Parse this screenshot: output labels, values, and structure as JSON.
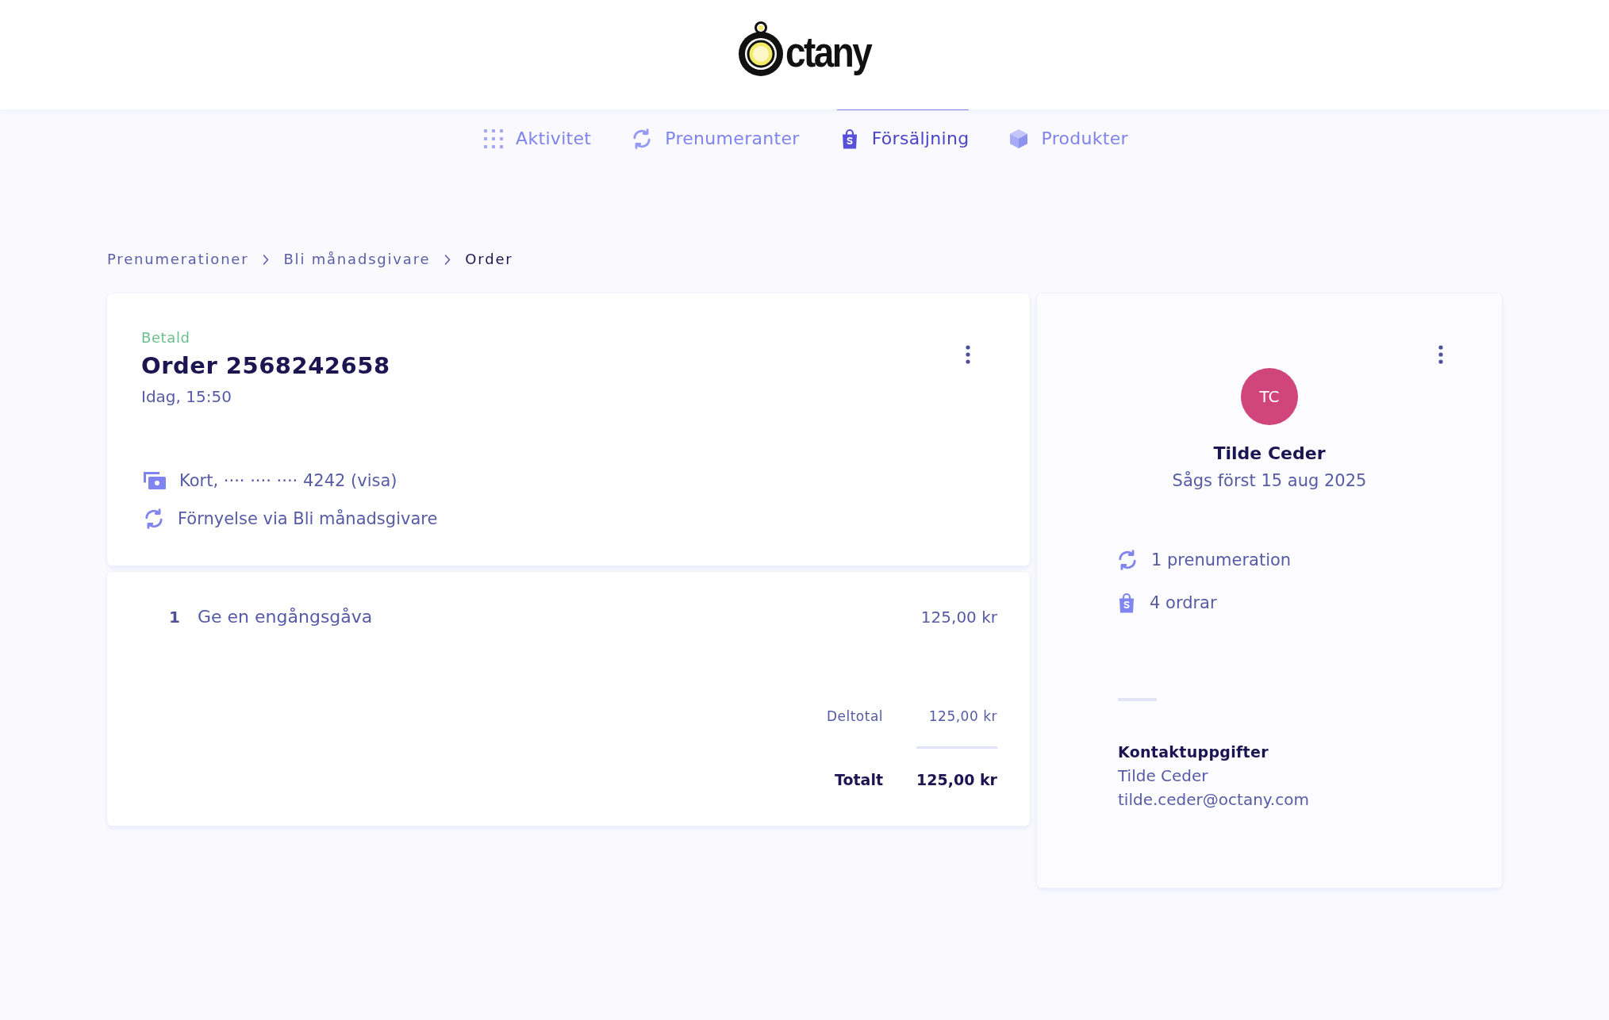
{
  "logo": {
    "text": "ctany"
  },
  "tabs": [
    {
      "label": "Aktivitet",
      "selected": false
    },
    {
      "label": "Prenumeranter",
      "selected": false
    },
    {
      "label": "Försäljning",
      "selected": true
    },
    {
      "label": "Produkter",
      "selected": false
    }
  ],
  "breadcrumb": [
    {
      "label": "Prenumerationer",
      "current": false
    },
    {
      "label": "Bli månadsgivare",
      "current": false
    },
    {
      "label": "Order",
      "current": true
    }
  ],
  "order": {
    "status": "Betald",
    "title": "Order 2568242658",
    "date": "Idag, 15:50",
    "details": [
      "Kort, ···· ···· ···· 4242 (visa)",
      "Förnyelse via Bli månadsgivare"
    ]
  },
  "line_items": [
    {
      "quantity": "1",
      "name": "Ge en engångsgåva",
      "price": "125,00 kr"
    }
  ],
  "totals": [
    {
      "kind": "subtotal",
      "label": "Deltotal",
      "value": "125,00 kr"
    },
    {
      "kind": "total",
      "label": "Totalt",
      "value": "125,00 kr"
    }
  ],
  "customer": {
    "initials": "TC",
    "name": "Tilde Ceder",
    "first_seen": "Sågs först 15 aug 2025",
    "stats": [
      "1 prenumeration",
      "4 ordrar"
    ],
    "contact": {
      "heading": "Kontaktuppgifter",
      "name": "Tilde Ceder",
      "email": "tilde.ceder@octany.com"
    }
  }
}
